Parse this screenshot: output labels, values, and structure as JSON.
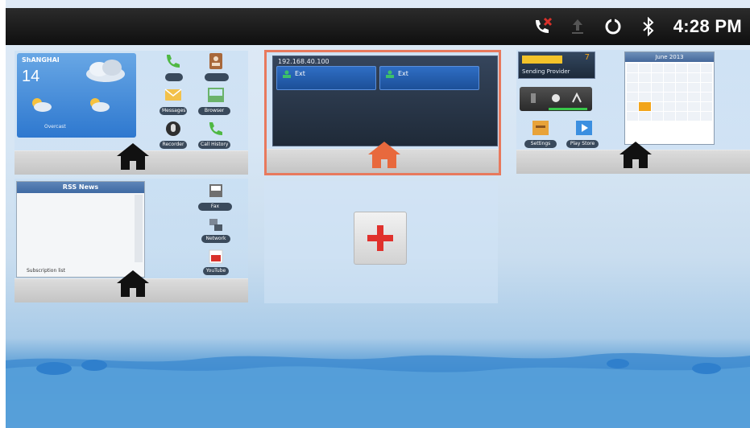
{
  "status_bar": {
    "time": "4:28 PM",
    "icons": [
      "missed-call-icon",
      "upload-icon",
      "sync-icon",
      "bluetooth-icon"
    ],
    "colors": {
      "missed": "#d9312b",
      "bar": "#1a1a1a"
    }
  },
  "cards": {
    "weather_card": {
      "city": "ShANGHAI",
      "temp": "14",
      "forecast_text": "Overcast",
      "apps": [
        {
          "icon": "phone-icon",
          "label": ""
        },
        {
          "icon": "contacts-icon",
          "label": ""
        },
        {
          "icon": "messages-icon",
          "label": "Messages"
        },
        {
          "icon": "browser-icon",
          "label": "Browser"
        },
        {
          "icon": "recorder-icon",
          "label": "Recorder"
        },
        {
          "icon": "call-history-icon",
          "label": "Call History"
        }
      ]
    },
    "phone_card": {
      "ip": "192.168.40.100",
      "lines": [
        {
          "name": "Ext",
          "sub": ""
        },
        {
          "name": "Ext",
          "sub": ""
        }
      ]
    },
    "calendar_card": {
      "status_label": "Sending Provider",
      "status_count": "7",
      "apps": [
        {
          "icon": "settings-icon",
          "label": "Settings"
        },
        {
          "icon": "play-store-icon",
          "label": "Play Store"
        }
      ],
      "month": "June 2013"
    },
    "rss_card": {
      "title": "RSS News",
      "footer": "Subscription list",
      "apps": [
        {
          "icon": "fax-icon",
          "label": "Fax"
        },
        {
          "icon": "network-icon",
          "label": "Network"
        },
        {
          "icon": "youtube-icon",
          "label": "YouTube"
        }
      ]
    }
  },
  "add_screen": {
    "icon": "plus-icon"
  },
  "accent": {
    "selected_border": "#e8795d",
    "home_selected": "#e8693d",
    "home_default": "#111111",
    "plus": "#e0312c"
  }
}
